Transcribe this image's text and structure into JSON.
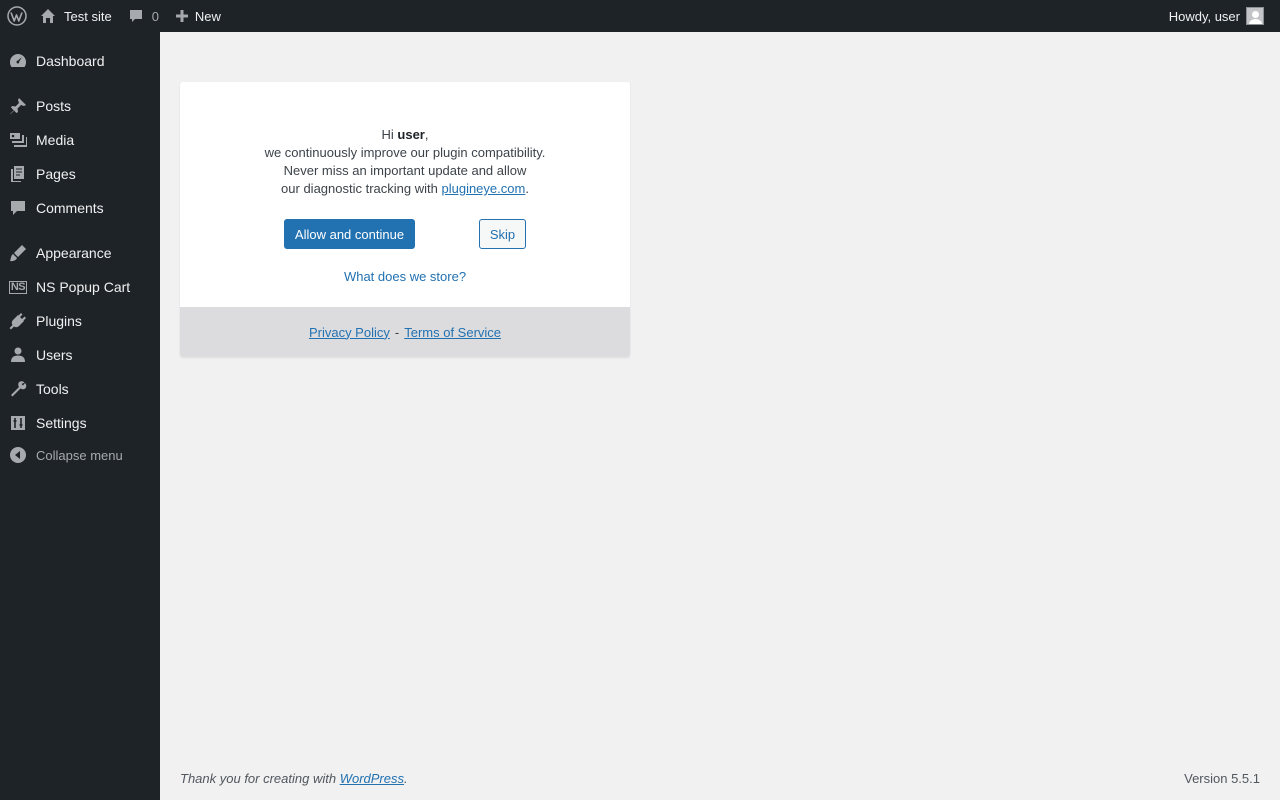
{
  "adminbar": {
    "site_name": "Test site",
    "comments_count": "0",
    "new_label": "New",
    "howdy": "Howdy, user"
  },
  "sidebar": {
    "items": [
      {
        "label": "Dashboard",
        "icon": "dashboard-icon"
      },
      {
        "label": "Posts",
        "icon": "pin-icon"
      },
      {
        "label": "Media",
        "icon": "media-icon"
      },
      {
        "label": "Pages",
        "icon": "pages-icon"
      },
      {
        "label": "Comments",
        "icon": "comment-icon"
      },
      {
        "label": "Appearance",
        "icon": "brush-icon"
      },
      {
        "label": "NS Popup Cart",
        "icon": "ns-logo-icon"
      },
      {
        "label": "Plugins",
        "icon": "plug-icon"
      },
      {
        "label": "Users",
        "icon": "user-icon"
      },
      {
        "label": "Tools",
        "icon": "wrench-icon"
      },
      {
        "label": "Settings",
        "icon": "sliders-icon"
      }
    ],
    "collapse_label": "Collapse menu",
    "ns_logo_text": "NS"
  },
  "optin": {
    "greeting_hi": "Hi",
    "user_name": "user",
    "greeting_comma": ",",
    "line1": "we continuously improve our plugin compatibility.",
    "line2": "Never miss an important update and allow",
    "line3_prefix": "our diagnostic tracking with",
    "link_text": "plugineye.com",
    "line3_suffix": ".",
    "allow_label": "Allow and continue",
    "skip_label": "Skip",
    "what_store": "What does we store?",
    "privacy": "Privacy Policy",
    "separator": "-",
    "terms": "Terms of Service"
  },
  "footer": {
    "thanks_prefix": "Thank you for creating with",
    "wordpress_link": "WordPress",
    "thanks_suffix": ".",
    "version": "Version 5.5.1"
  },
  "colors": {
    "adminbar_bg": "#1d2327",
    "accent": "#2271b1",
    "content_bg": "#f1f1f1"
  }
}
